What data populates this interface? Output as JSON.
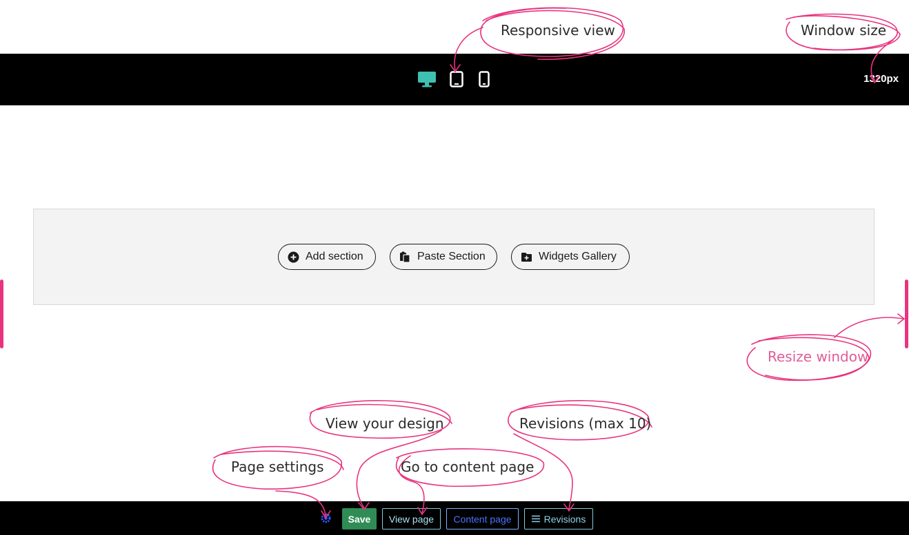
{
  "toolbar": {
    "devices": [
      {
        "name": "desktop",
        "icon": "desktop-icon",
        "active": true
      },
      {
        "name": "tablet",
        "icon": "tablet-icon",
        "active": false
      },
      {
        "name": "mobile",
        "icon": "mobile-icon",
        "active": false
      }
    ],
    "window_size": "1320px"
  },
  "canvas": {
    "add_section": "Add section",
    "paste_section": "Paste Section",
    "widgets_gallery": "Widgets Gallery"
  },
  "bottombar": {
    "save": "Save",
    "view_page": "View page",
    "content_page": "Content page",
    "revisions": "Revisions"
  },
  "annotations": {
    "responsive_view": "Responsive view",
    "window_size": "Window size",
    "resize_window": "Resize window",
    "view_design": "View your design",
    "revisions": "Revisions (max 10)",
    "page_settings": "Page settings",
    "content_page": "Go to content page"
  },
  "colors": {
    "accent_active": "#3fc0b0",
    "save_green": "#2f8c55",
    "annotation_pink": "#e8337e"
  }
}
